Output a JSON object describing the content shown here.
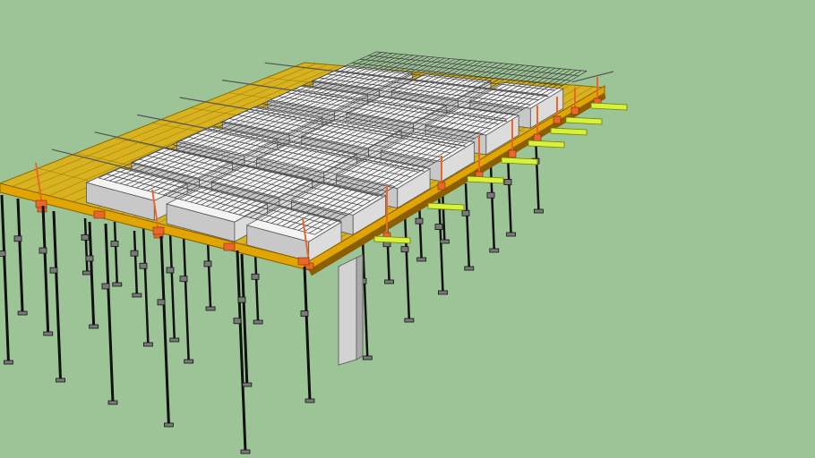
{
  "viewport": {
    "background": "#9dc497",
    "colors": {
      "deck": "#d9b21f",
      "deck_line": "#8a6d00",
      "beam": "#e0a500",
      "beam_dark": "#8b5e00",
      "tie": "#e8672a",
      "yellow_green": "#d8f23c",
      "prop": "#111111",
      "prop_clamp": "#7a7a7a",
      "block": "#f4f4f4",
      "block_shade": "#c8c8c8",
      "rebar": "#3c3c3c",
      "column": "#d2d2d2",
      "column_shade": "#a9a9a9"
    }
  }
}
